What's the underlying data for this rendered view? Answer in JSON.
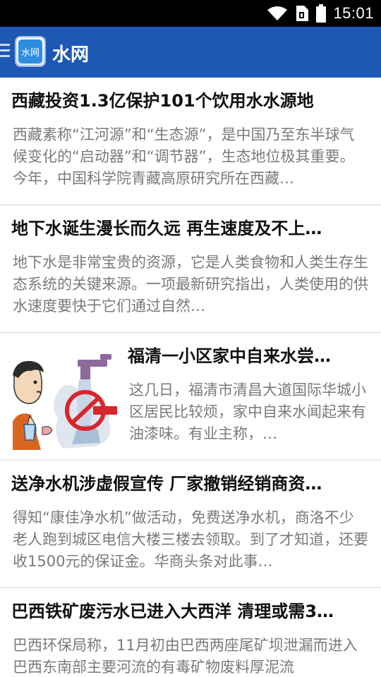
{
  "status_bar": {
    "time": "15:01",
    "icons": [
      "wifi-icon",
      "sim-icon",
      "battery-icon"
    ]
  },
  "app_bar": {
    "title": "水网",
    "logo_text": "水网",
    "menu_icon": "menu-icon"
  },
  "colors": {
    "app_bar": "#1e58b5",
    "title_text": "#111111",
    "summary_text": "#7a7a7a",
    "divider": "#d8d8d8"
  },
  "news": [
    {
      "title": "西藏投资1.3亿保护101个饮用水水源地",
      "summary": "西藏素称“江河源”和“生态源”，是中国乃至东半球气候变化的“启动器”和“调节器”，生态地位极其重要。今年，中国科学院青藏高原研究所在西藏…"
    },
    {
      "title": "地下水诞生漫长而久远 再生速度及不上…",
      "summary": "地下水是非常宝贵的资源，它是人类食物和人类生存生态系统的关键来源。一项最新研究指出，人类使用的供水速度要快于它们通过自然…"
    },
    {
      "title": "福清一小区家中自来水尝…",
      "summary": "这几日，福清市清昌大道国际华城小区居民比较烦，家中自来水闻起来有油漆味。有业主称，…",
      "thumbnail": "cartoon-man-with-water-glass-and-no-tap-sign"
    },
    {
      "title": "送净水机涉虚假宣传 厂家撤销经销商资…",
      "summary": "得知“康佳净水机”做活动，免费送净水机，商洛不少老人跑到城区电信大楼三楼去领取。到了才知道，还要收1500元的保证金。华商头条对此事…"
    },
    {
      "title": "巴西铁矿废污水已进入大西洋 清理或需3…",
      "summary": "巴西环保局称，11月初由巴西两座尾矿坝泄漏而进入巴西东南部主要河流的有毒矿物废料厚泥流"
    }
  ]
}
